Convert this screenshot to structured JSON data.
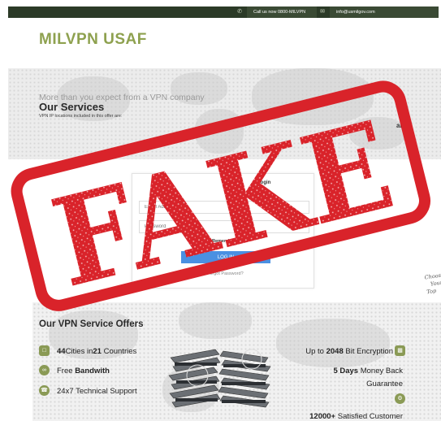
{
  "topbar": {
    "phone_icon": "phone-icon",
    "phone_text": "Call us now 0800-MILVPN",
    "mail_icon": "mail-icon",
    "mail_text": "info@usmilgov.com",
    "bar_color": "#2b3a27"
  },
  "brand": {
    "logo_text": "MILVPN USAF",
    "logo_color": "#8ea14f"
  },
  "services": {
    "tagline": "More than you expect from a VPN company",
    "title": "Our Services",
    "subtitle": "VPN IP locations included in this offer are:",
    "fragment": "ait,"
  },
  "login": {
    "label": "Login",
    "email_placeholder": "Email Address",
    "password_placeholder": "Password",
    "remember_label": "Remember Me",
    "button_label": "LOG IN",
    "forgot_label": "Forgot Password?",
    "button_color": "#4a90e2"
  },
  "offers": {
    "title": "Our VPN Service Offers",
    "left": [
      {
        "icon": "globe-icon",
        "pre": "",
        "count1": "44",
        "mid": "Cities in",
        "count2": "21",
        "post": " Countries"
      },
      {
        "icon": "infinity-icon",
        "text": "Free ",
        "bold": "Bandwith"
      },
      {
        "icon": "support-icon",
        "text": "24x7 Technical Support"
      }
    ],
    "right": {
      "encryption_pre": "Up to ",
      "encryption_bold": "2048",
      "encryption_post": " Bit Encryption",
      "money_bold": "5 Days",
      "money_text": " Money Back",
      "money_line2": "Guarantee",
      "customers_bold": "12000+",
      "customers_text": " Satisfied Customer"
    },
    "accent_color": "#8a9a55"
  },
  "side_note": [
    "Choos",
    "Your",
    "Top"
  ],
  "stamp": {
    "text": "FAKE",
    "color": "#d9232a"
  }
}
